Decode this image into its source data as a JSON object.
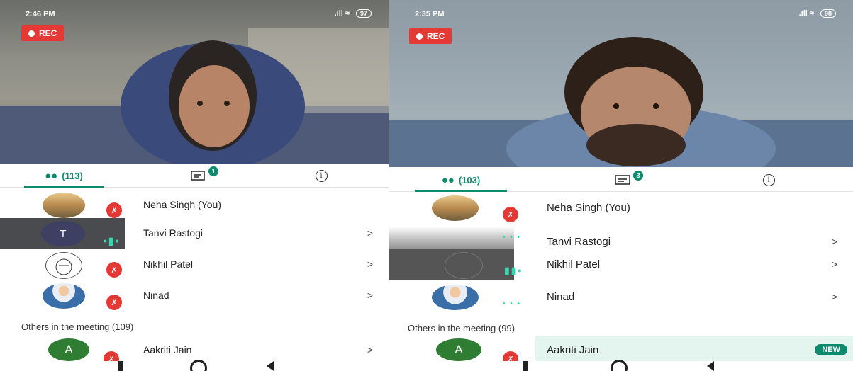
{
  "left": {
    "status": {
      "time": "2:46 PM",
      "battery": "97"
    },
    "rec_label": "REC",
    "tabs": {
      "people_count": "(113)",
      "chat_badge": "1"
    },
    "participants": [
      {
        "name": "Neha Singh (You)",
        "chevron": ""
      },
      {
        "name": "Tanvi Rastogi",
        "chevron": ">",
        "initial": "T"
      },
      {
        "name": "Nikhil Patel",
        "chevron": ">"
      },
      {
        "name": "Ninad",
        "chevron": ">"
      }
    ],
    "others_title": "Others in the meeting (109)",
    "others": [
      {
        "name": "Aakriti Jain",
        "chevron": ">",
        "initial": "A"
      }
    ]
  },
  "right": {
    "status": {
      "time": "2:35 PM",
      "battery": "98"
    },
    "rec_label": "REC",
    "tabs": {
      "people_count": "(103)",
      "chat_badge": "3"
    },
    "participants": [
      {
        "name": "Neha Singh (You)",
        "chevron": ""
      },
      {
        "name": "Tanvi Rastogi",
        "chevron": ">"
      },
      {
        "name": "Nikhil Patel",
        "chevron": ">"
      },
      {
        "name": "Ninad",
        "chevron": ">"
      }
    ],
    "others_title": "Others in the meeting (99)",
    "others": [
      {
        "name": "Aakriti Jain",
        "badge": "NEW",
        "initial": "A"
      }
    ]
  },
  "icons": {
    "people": "people-icon",
    "chat": "chat-icon",
    "info": "info-icon",
    "mute": "mic-off-icon",
    "speaking": "speaking-icon"
  },
  "colors": {
    "accent": "#0b8a6d",
    "rec": "#e53935",
    "avatar_tanvi": "#3d3f63",
    "avatar_aakriti": "#2e7d32"
  }
}
